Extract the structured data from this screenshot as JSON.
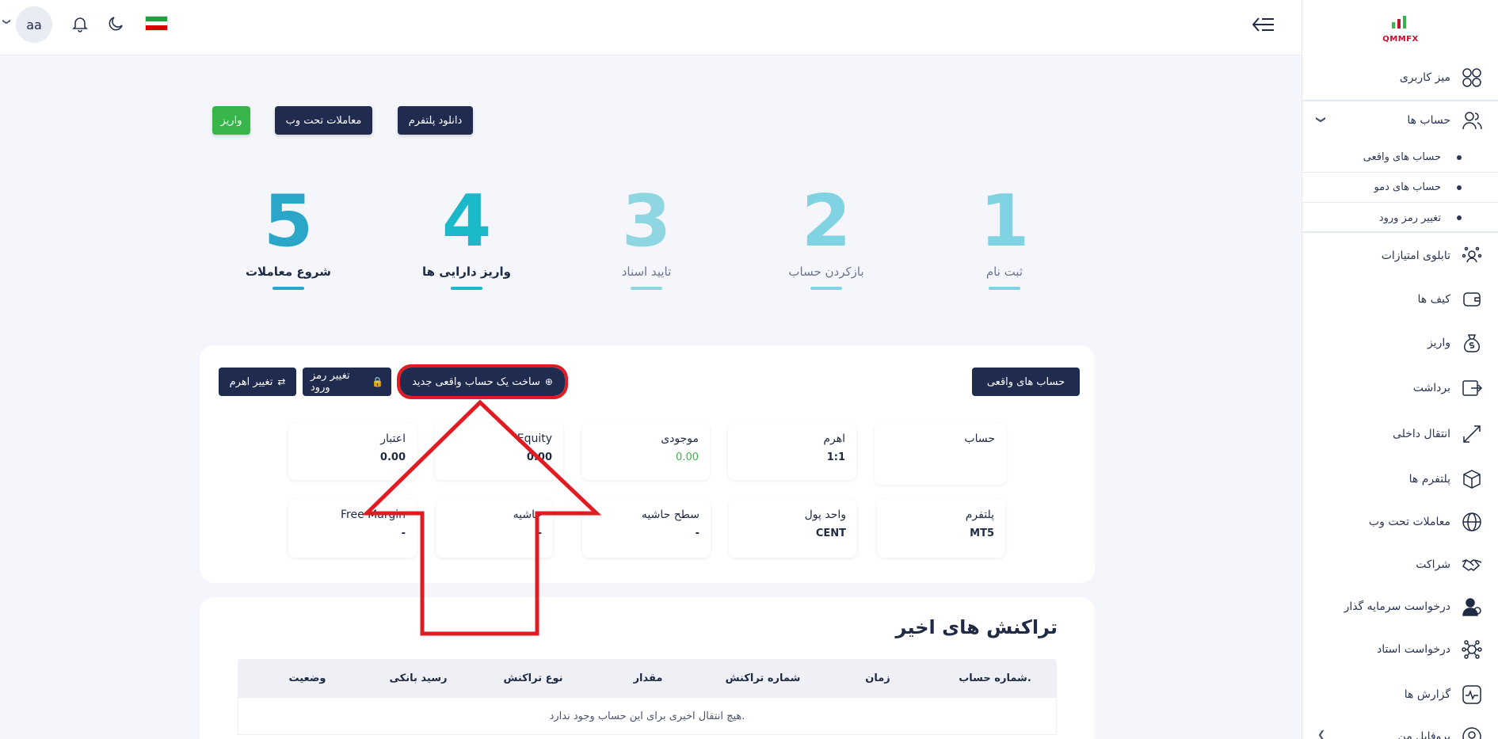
{
  "sidebar": {
    "logo_text": "QMMFX",
    "items": [
      {
        "label": "میز کاربری",
        "icon": "dashboard-grid-icon"
      },
      {
        "label": "حساب ها",
        "icon": "users-icon"
      },
      {
        "label": "تابلوی امتیازات",
        "icon": "leaderboard-icon"
      },
      {
        "label": "کیف ها",
        "icon": "wallet-icon"
      },
      {
        "label": "واریز",
        "icon": "money-bag-icon"
      },
      {
        "label": "برداشت",
        "icon": "withdraw-icon"
      },
      {
        "label": "انتقال داخلی",
        "icon": "transfer-icon"
      },
      {
        "label": "پلتفرم ها",
        "icon": "cube-icon"
      },
      {
        "label": "معاملات تحت وب",
        "icon": "globe-icon"
      },
      {
        "label": "شراکت",
        "icon": "handshake-icon"
      },
      {
        "label": "درخواست سرمایه گذار",
        "icon": "investor-icon"
      },
      {
        "label": "درخواست استاد",
        "icon": "network-icon"
      },
      {
        "label": "گزارش ها",
        "icon": "report-icon"
      },
      {
        "label": "پروفایل من",
        "icon": "profile-icon"
      }
    ],
    "account_subitems": [
      {
        "label": "حساب های واقعی"
      },
      {
        "label": "حساب های دمو"
      },
      {
        "label": "تغییر رمز ورود"
      }
    ]
  },
  "header": {
    "avatar_text": "aa",
    "flag_colors": [
      "#239f40",
      "#ffffff",
      "#da0000"
    ]
  },
  "actions": {
    "deposit": "واریز",
    "web_trading": "معاملات تحت وب",
    "download_platform": "دانلود پلتفرم"
  },
  "steps": [
    {
      "num": "1",
      "label": "ثبت نام",
      "color": "#7fd3e3",
      "active": false
    },
    {
      "num": "2",
      "label": "بازکردن حساب",
      "color": "#7fd3e3",
      "active": false
    },
    {
      "num": "3",
      "label": "تایید اسناد",
      "color": "#8fd6e3",
      "active": false
    },
    {
      "num": "4",
      "label": "واریز دارایی ها",
      "color": "#1bb8c9",
      "active": true
    },
    {
      "num": "5",
      "label": "شروع معاملات",
      "color": "#2aa6c9",
      "active": true
    }
  ],
  "account_card": {
    "real_accounts_btn": "حساب های واقعی",
    "new_account_btn": "ساخت یک حساب واقعی جدید",
    "change_password_btn": "تغییر رمز ورود",
    "change_leverage_btn": "تغییر اهرم",
    "row1": [
      {
        "key": "حساب",
        "value": ""
      },
      {
        "key": "اهرم",
        "value": "1:1"
      },
      {
        "key": "موجودی",
        "value": "0.00"
      },
      {
        "key": "Equity",
        "value": "0.00"
      },
      {
        "key": "اعتبار",
        "value": "0.00"
      }
    ],
    "row2": [
      {
        "key": "پلتفرم",
        "value": "MT5"
      },
      {
        "key": "واحد پول",
        "value": "CENT"
      },
      {
        "key": "سطح حاشیه",
        "value": "-"
      },
      {
        "key": "حاشیه",
        "value": "-"
      },
      {
        "key": "Free Margin",
        "value": "-"
      }
    ]
  },
  "transactions": {
    "title": "تراکنش های اخیر",
    "columns": [
      "شماره حساب.",
      "زمان",
      "شماره تراکنش",
      "مقدار",
      "نوع تراکنش",
      "رسید بانکی",
      "وضعیت"
    ],
    "empty_text": "هیچ انتقال اخیری برای این حساب وجود ندارد."
  },
  "annotation_color": "#e21b23"
}
